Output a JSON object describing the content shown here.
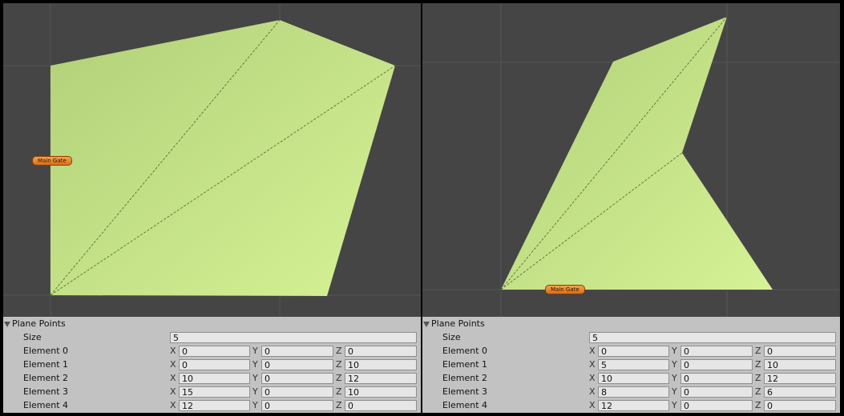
{
  "panes": [
    {
      "gate_label": "Main Gate",
      "inspector": {
        "title": "Plane Points",
        "size_label": "Size",
        "size_value": "5",
        "elements": [
          {
            "label": "Element 0",
            "x": "0",
            "y": "0",
            "z": "0"
          },
          {
            "label": "Element 1",
            "x": "0",
            "y": "0",
            "z": "10"
          },
          {
            "label": "Element 2",
            "x": "10",
            "y": "0",
            "z": "12"
          },
          {
            "label": "Element 3",
            "x": "15",
            "y": "0",
            "z": "10"
          },
          {
            "label": "Element 4",
            "x": "12",
            "y": "0",
            "z": "0"
          }
        ]
      }
    },
    {
      "gate_label": "Main Gate",
      "inspector": {
        "title": "Plane Points",
        "size_label": "Size",
        "size_value": "5",
        "elements": [
          {
            "label": "Element 0",
            "x": "0",
            "y": "0",
            "z": "0"
          },
          {
            "label": "Element 1",
            "x": "5",
            "y": "0",
            "z": "10"
          },
          {
            "label": "Element 2",
            "x": "10",
            "y": "0",
            "z": "12"
          },
          {
            "label": "Element 3",
            "x": "8",
            "y": "0",
            "z": "6"
          },
          {
            "label": "Element 4",
            "x": "12",
            "y": "0",
            "z": "0"
          }
        ]
      }
    }
  ],
  "axis_labels": {
    "x": "X",
    "y": "Y",
    "z": "Z"
  },
  "colors": {
    "scene_bg": "#454545",
    "mesh_light": "#d4f095",
    "mesh_dark": "#b4d47a",
    "inspector_bg": "#c2c2c2"
  }
}
